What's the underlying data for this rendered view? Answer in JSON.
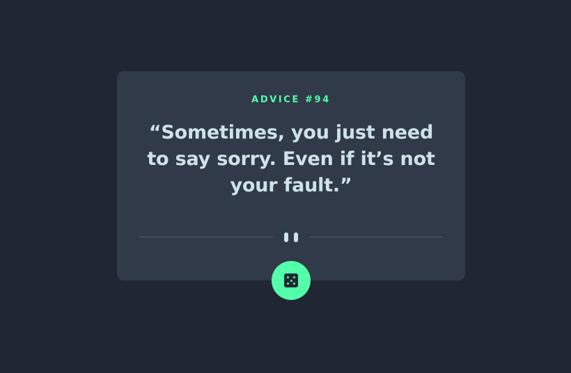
{
  "advice": {
    "id_label": "ADVICE #94",
    "quote": "“Sometimes, you just need to say sorry. Even if it’s not your fault.”"
  },
  "divider": {
    "icon": "pause-icon"
  },
  "button": {
    "icon": "dice-icon"
  },
  "colors": {
    "background": "#202733",
    "card": "#313a48",
    "accent": "#53ffaa",
    "text": "#cee3e9",
    "divider": "#4f5d74"
  }
}
